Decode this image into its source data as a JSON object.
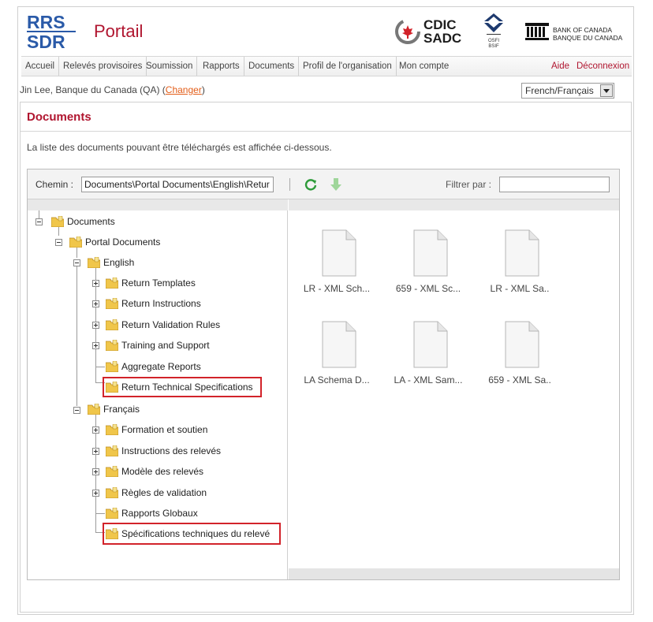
{
  "header": {
    "logo_top": "RRS",
    "logo_bottom": "SDR",
    "title": "Portail",
    "cdic_line1": "CDIC",
    "cdic_line2": "SADC",
    "osfi_line1": "OSFI",
    "osfi_line2": "BSIF",
    "boc_line1": "BANK OF CANADA",
    "boc_line2": "BANQUE DU CANADA"
  },
  "nav": {
    "items": [
      "Accueil",
      "Relevés provisoires",
      "Soumission",
      "Rapports",
      "Documents",
      "Profil de l'organisation",
      "Mon compte"
    ],
    "help": "Aide",
    "logout": "Déconnexion"
  },
  "user": {
    "prefix": "Jin Lee, Banque du Canada (QA) (",
    "change": "Changer",
    "suffix": ")"
  },
  "language": {
    "selected": "French/Français"
  },
  "documents": {
    "title": "Documents",
    "description": "La liste des documents pouvant être téléchargés est affichée ci-dessous."
  },
  "toolbar": {
    "path_label": "Chemin :",
    "path_value": "Documents\\Portal Documents\\English\\Retur",
    "filter_label": "Filtrer par :",
    "filter_value": ""
  },
  "tree": {
    "root": "Documents",
    "portal": "Portal Documents",
    "english": "English",
    "english_children": [
      "Return Templates",
      "Return Instructions",
      "Return Validation Rules",
      "Training and Support",
      "Aggregate Reports",
      "Return Technical Specifications"
    ],
    "french": "Français",
    "french_children": [
      "Formation et soutien",
      "Instructions des relevés",
      "Modèle des relevés",
      "Règles de validation",
      "Rapports Globaux",
      "Spécifications techniques du relevé"
    ]
  },
  "files": [
    "LR - XML Sch...",
    "659 - XML Sc...",
    "LR - XML Sa..",
    "LA Schema D...",
    "LA - XML Sam...",
    "659 - XML Sa.."
  ],
  "colors": {
    "brand_red": "#b0152f",
    "link_orange": "#e35d18",
    "highlight_red": "#d2232a",
    "rrs_blue": "#2a5aa8"
  }
}
